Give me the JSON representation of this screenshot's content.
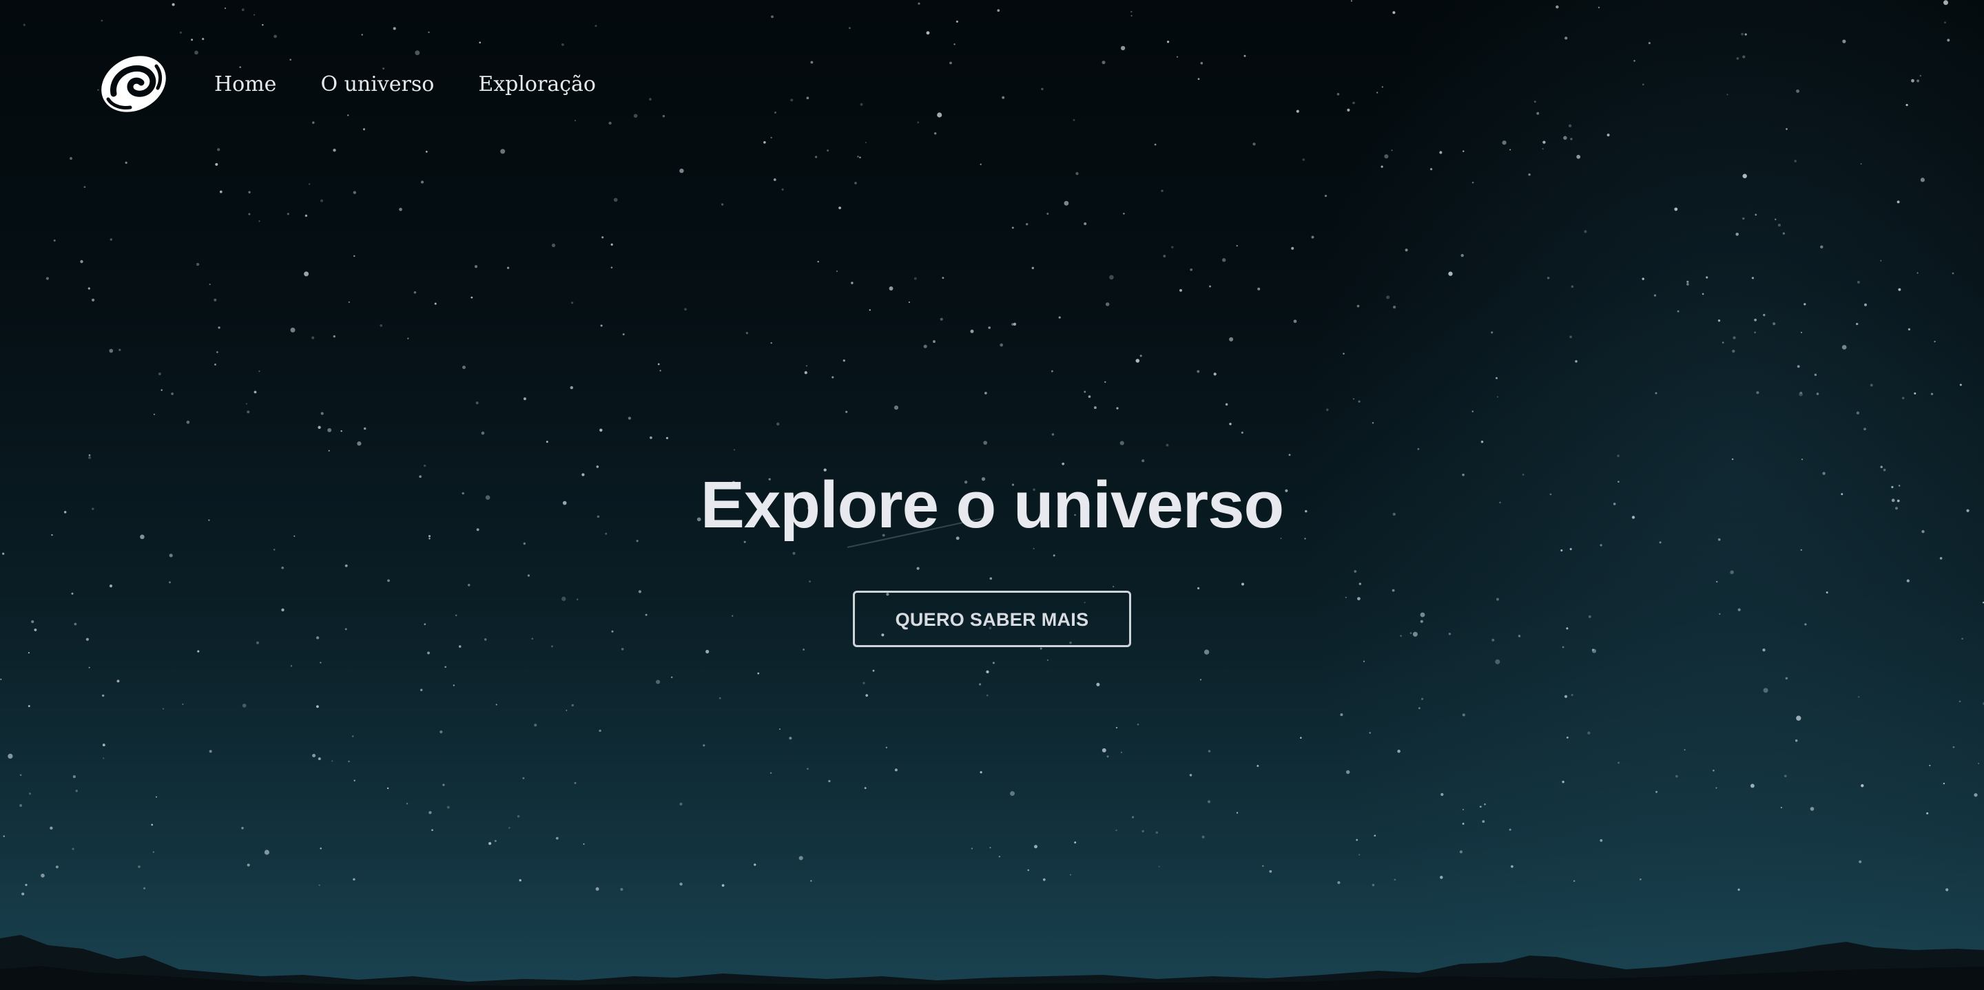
{
  "nav": {
    "logo_icon": "spiral-galaxy-icon",
    "links": [
      {
        "label": "Home"
      },
      {
        "label": "O universo"
      },
      {
        "label": "Exploração"
      }
    ]
  },
  "hero": {
    "title": "Explore o universo",
    "cta_label": "QUERO SABER MAIS"
  },
  "colors": {
    "background_top": "#03090c",
    "background_bottom": "#1a4250",
    "text": "#e8e9ee",
    "button_border": "#cfd4da"
  }
}
